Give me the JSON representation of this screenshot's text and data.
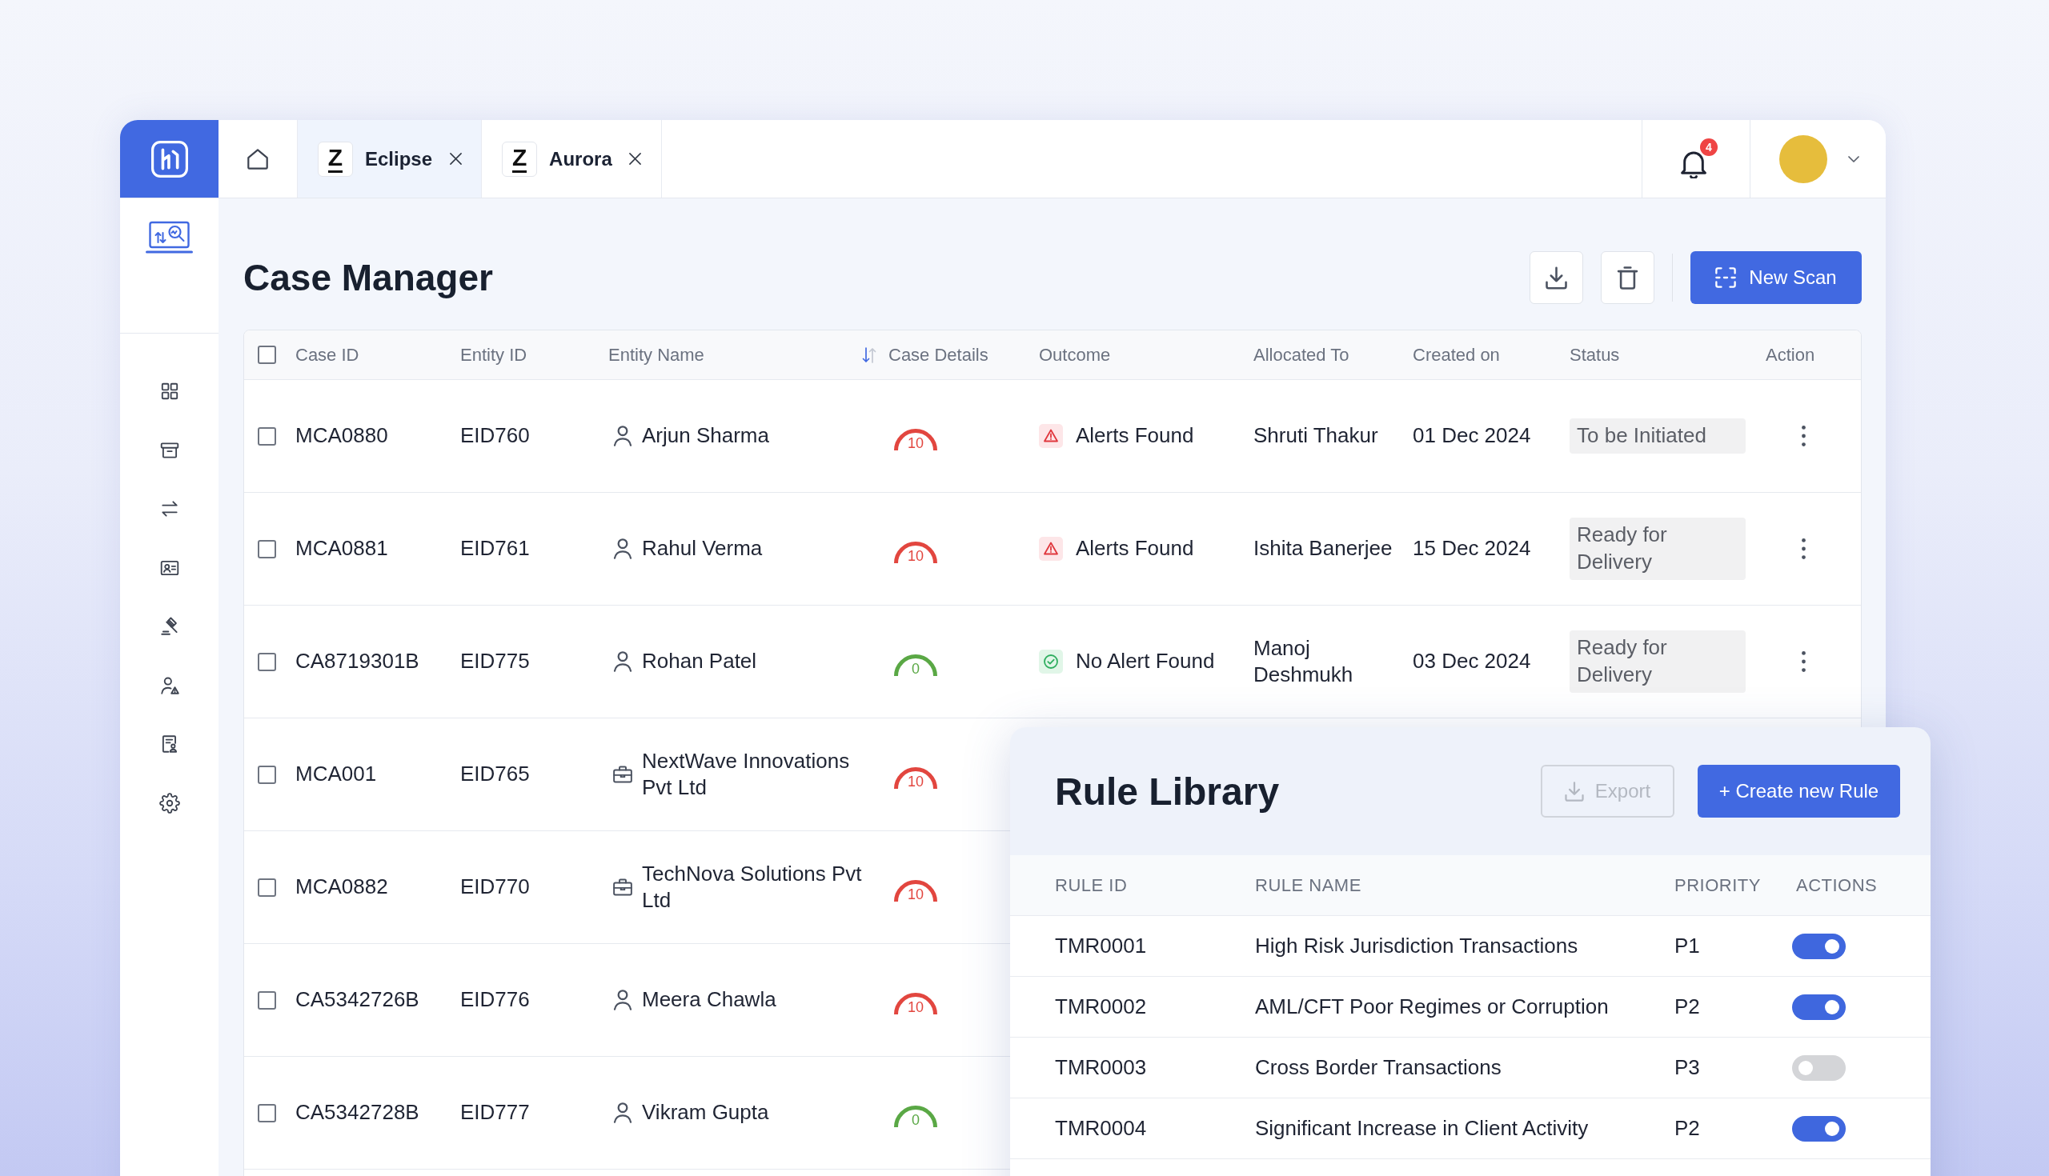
{
  "tabs": [
    {
      "kind": "home",
      "selected": false
    },
    {
      "kind": "workspace",
      "logo": "Z",
      "label": "Eclipse",
      "selected": true
    },
    {
      "kind": "workspace",
      "logo": "Z",
      "label": "Aurora",
      "selected": false
    }
  ],
  "notifications": {
    "count": "4"
  },
  "sidebar": {
    "items": [
      {
        "kind": "dashboard"
      },
      {
        "kind": "archive"
      },
      {
        "kind": "transfer"
      },
      {
        "kind": "id-card"
      },
      {
        "kind": "gavel"
      },
      {
        "kind": "user-alert"
      },
      {
        "kind": "report"
      },
      {
        "kind": "settings"
      }
    ]
  },
  "page": {
    "title": "Case Manager",
    "actions": [
      {
        "kind": "download"
      },
      {
        "kind": "delete"
      },
      {
        "kind": "scan",
        "label": "New Scan"
      }
    ]
  },
  "case_table": {
    "select_all": {
      "checked": false
    },
    "columns": [
      {
        "label": "Case ID"
      },
      {
        "label": "Entity ID"
      },
      {
        "label": "Entity Name",
        "sort": {
          "kind": "descending"
        }
      },
      {
        "label": "Case Details"
      },
      {
        "label": "Outcome"
      },
      {
        "label": "Allocated To"
      },
      {
        "label": "Created on"
      },
      {
        "label": "Status"
      },
      {
        "label": "Action"
      }
    ],
    "rows": [
      {
        "checked": false,
        "case_id": "MCA0880",
        "entity_id": "EID760",
        "entity": {
          "kind": "person",
          "name": "Arjun Sharma"
        },
        "score": {
          "value": "10",
          "color": "#e2463f"
        },
        "outcome": {
          "kind": "alert",
          "label": "Alerts Found"
        },
        "allocated_to": "Shruti Thakur",
        "created_on": "01 Dec 2024",
        "status": "To be Initiated",
        "more_menu": true
      },
      {
        "checked": false,
        "case_id": "MCA0881",
        "entity_id": "EID761",
        "entity": {
          "kind": "person",
          "name": "Rahul Verma"
        },
        "score": {
          "value": "10",
          "color": "#e2463f"
        },
        "outcome": {
          "kind": "alert",
          "label": "Alerts Found"
        },
        "allocated_to": "Ishita Banerjee",
        "created_on": "15 Dec 2024",
        "status": "Ready for Delivery",
        "more_menu": true
      },
      {
        "checked": false,
        "case_id": "CA8719301B",
        "entity_id": "EID775",
        "entity": {
          "kind": "person",
          "name": "Rohan Patel"
        },
        "score": {
          "value": "0",
          "color": "#5aa845"
        },
        "outcome": {
          "kind": "clear",
          "label": "No Alert Found"
        },
        "allocated_to": "Manoj Deshmukh",
        "created_on": "03 Dec 2024",
        "status": "Ready for Delivery",
        "more_menu": true
      },
      {
        "checked": false,
        "case_id": "MCA001",
        "entity_id": "EID765",
        "entity": {
          "kind": "company",
          "name": "NextWave Innovations Pvt Ltd"
        },
        "score": {
          "value": "10",
          "color": "#e2463f"
        }
      },
      {
        "checked": false,
        "case_id": "MCA0882",
        "entity_id": "EID770",
        "entity": {
          "kind": "company",
          "name": "TechNova Solutions Pvt Ltd"
        },
        "score": {
          "value": "10",
          "color": "#e2463f"
        }
      },
      {
        "checked": false,
        "case_id": "CA5342726B",
        "entity_id": "EID776",
        "entity": {
          "kind": "person",
          "name": "Meera Chawla"
        },
        "score": {
          "value": "10",
          "color": "#e2463f"
        }
      },
      {
        "checked": false,
        "case_id": "CA5342728B",
        "entity_id": "EID777",
        "entity": {
          "kind": "person",
          "name": "Vikram Gupta"
        },
        "score": {
          "value": "0",
          "color": "#5aa845"
        }
      }
    ]
  },
  "rule_library": {
    "title": "Rule Library",
    "export": {
      "label": "Export",
      "disabled": true
    },
    "create": {
      "label": "+ Create new Rule"
    },
    "columns": [
      "RULE ID",
      "RULE NAME",
      "PRIORITY",
      "ACTIONS"
    ],
    "rules": [
      {
        "id": "TMR0001",
        "name": "High Risk Jurisdiction Transactions",
        "priority": "P1",
        "enabled": true
      },
      {
        "id": "TMR0002",
        "name": "AML/CFT Poor Regimes or Corruption",
        "priority": "P2",
        "enabled": true
      },
      {
        "id": "TMR0003",
        "name": "Cross Border Transactions",
        "priority": "P3",
        "enabled": false
      },
      {
        "id": "TMR0004",
        "name": "Significant Increase in Client Activity",
        "priority": "P2",
        "enabled": true
      }
    ]
  }
}
